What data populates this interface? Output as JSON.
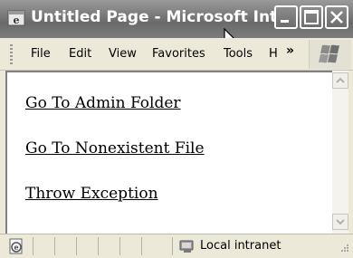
{
  "window": {
    "title": "Untitled Page - Microsoft Inter...",
    "title_icon": "internet-explorer-icon",
    "controls": [
      "minimize-icon",
      "maximize-icon",
      "close-icon"
    ]
  },
  "menubar": {
    "items": [
      "File",
      "Edit",
      "View",
      "Favorites",
      "Tools",
      "H"
    ],
    "overflow_label": "»"
  },
  "page": {
    "links": [
      {
        "label": "Go To Admin Folder"
      },
      {
        "label": "Go To Nonexistent File"
      },
      {
        "label": "Throw Exception"
      }
    ]
  },
  "statusbar": {
    "page_icon": "ie-page-icon",
    "zone_icon": "local-intranet-icon",
    "zone_label": "Local intranet"
  },
  "colors": {
    "titlebar": "#7a7a7a",
    "chrome": "#ece9d8",
    "content_bg": "#ffffff"
  }
}
